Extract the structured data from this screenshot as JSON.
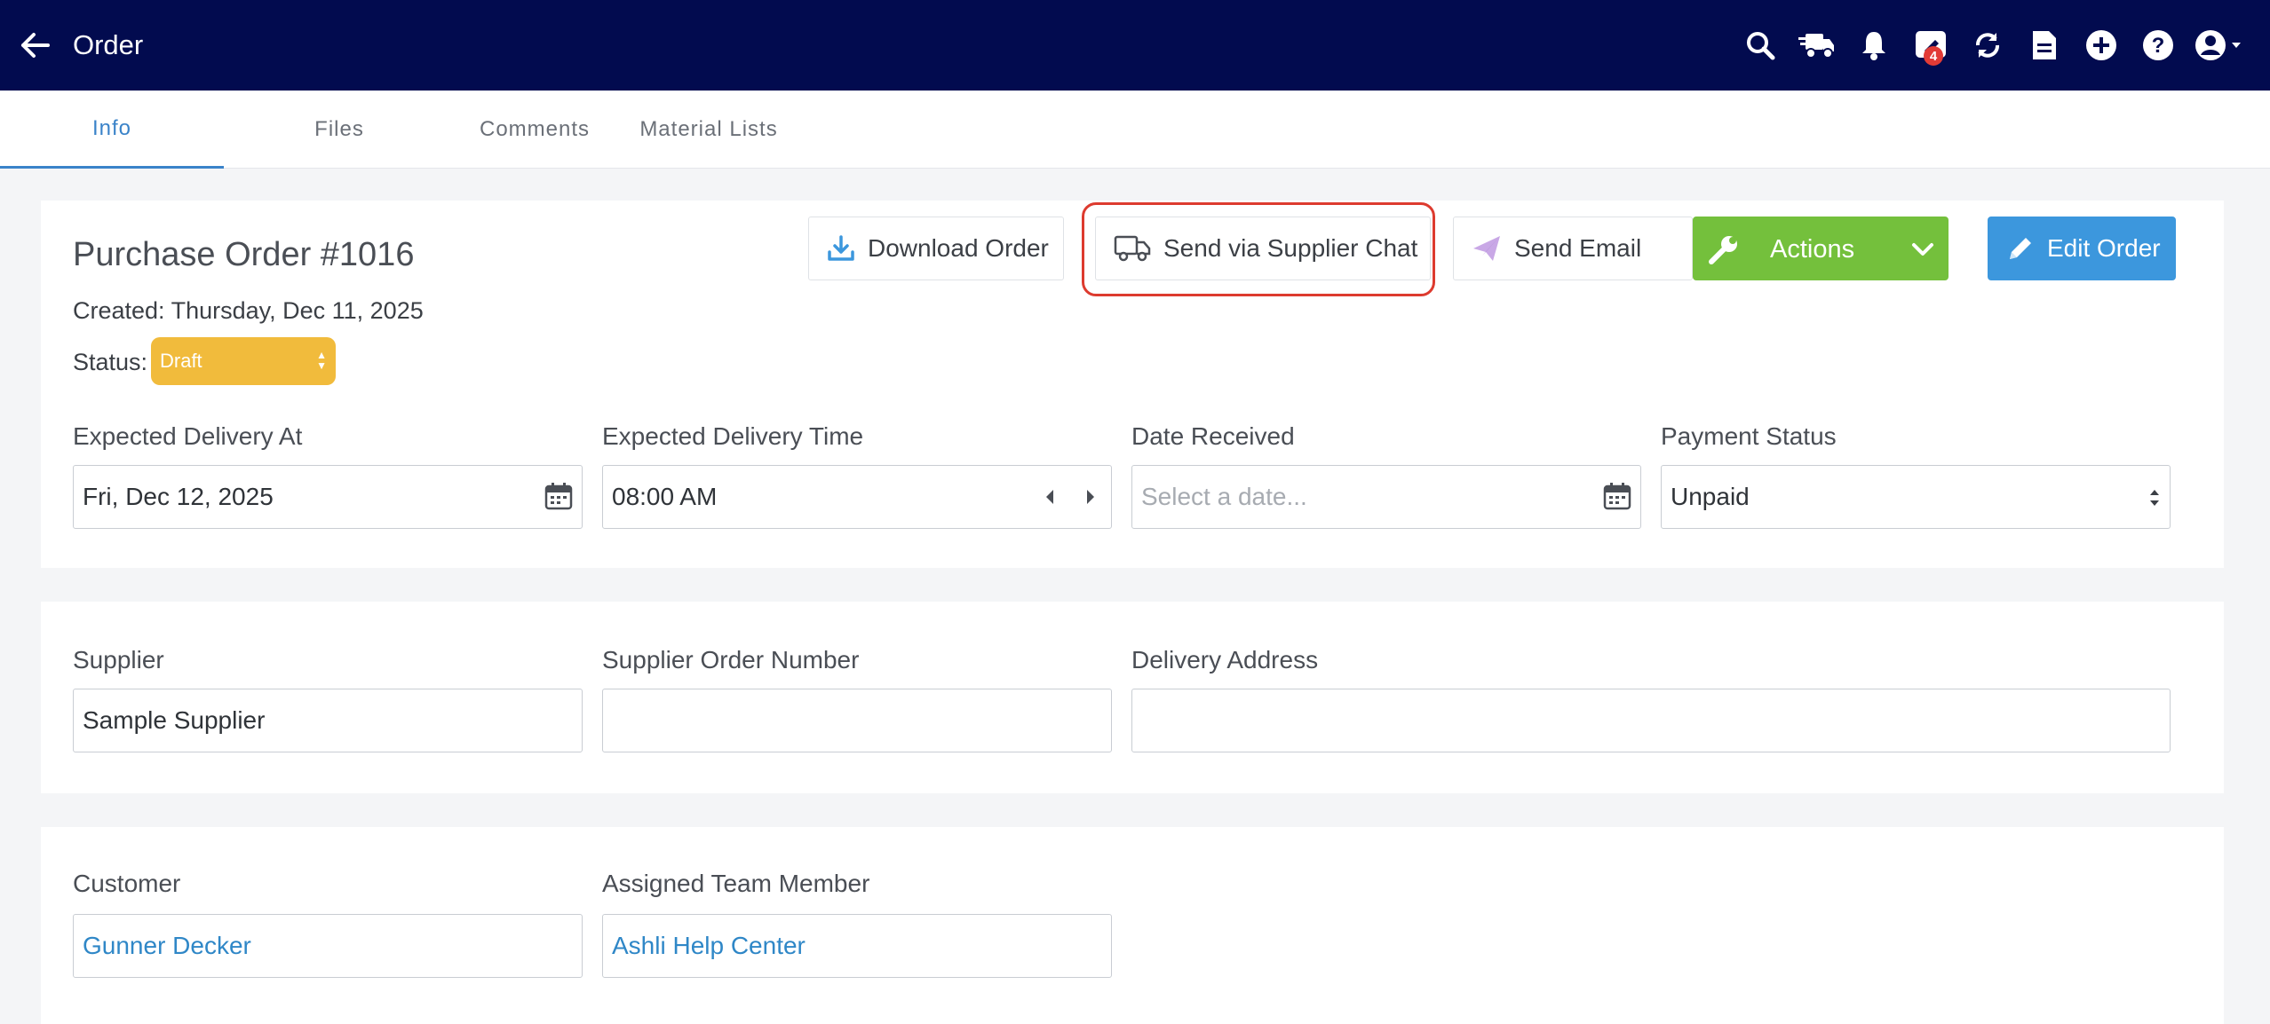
{
  "header": {
    "title": "Order",
    "notification_badge": "4",
    "icons": [
      "search-icon",
      "truck-icon",
      "bell-icon",
      "chat-icon",
      "sync-icon",
      "document-icon",
      "plus-circle-icon",
      "help-icon",
      "user-menu-icon"
    ]
  },
  "tabs": [
    {
      "label": "Info",
      "active": true
    },
    {
      "label": "Files",
      "active": false
    },
    {
      "label": "Comments",
      "active": false
    },
    {
      "label": "Material Lists",
      "active": false
    }
  ],
  "order": {
    "title": "Purchase Order #1016",
    "created": "Created: Thursday, Dec 11, 2025",
    "status_label": "Status:",
    "status_value": "Draft"
  },
  "toolbar": {
    "download_label": "Download Order",
    "supplier_chat_label": "Send via Supplier Chat",
    "email_label": "Send Email",
    "actions_label": "Actions",
    "edit_label": "Edit Order"
  },
  "fields": {
    "expected_delivery_at": {
      "label": "Expected Delivery At",
      "value": "Fri, Dec 12, 2025"
    },
    "expected_delivery_time": {
      "label": "Expected Delivery Time",
      "value": "08:00 AM"
    },
    "date_received": {
      "label": "Date Received",
      "placeholder": "Select a date..."
    },
    "payment_status": {
      "label": "Payment Status",
      "value": "Unpaid"
    },
    "supplier": {
      "label": "Supplier",
      "value": "Sample Supplier"
    },
    "supplier_order_number": {
      "label": "Supplier Order Number",
      "value": ""
    },
    "delivery_address": {
      "label": "Delivery Address",
      "value": ""
    },
    "customer": {
      "label": "Customer",
      "value": "Gunner Decker"
    },
    "assigned_team_member": {
      "label": "Assigned Team Member",
      "value": "Ashli Help Center"
    }
  },
  "colors": {
    "topbar": "#020b4f",
    "accent_blue": "#3a83c9",
    "status_draft": "#f1bb3c",
    "actions_green": "#74c03c",
    "edit_blue": "#3c97dd",
    "highlight": "#dd3b2f"
  }
}
